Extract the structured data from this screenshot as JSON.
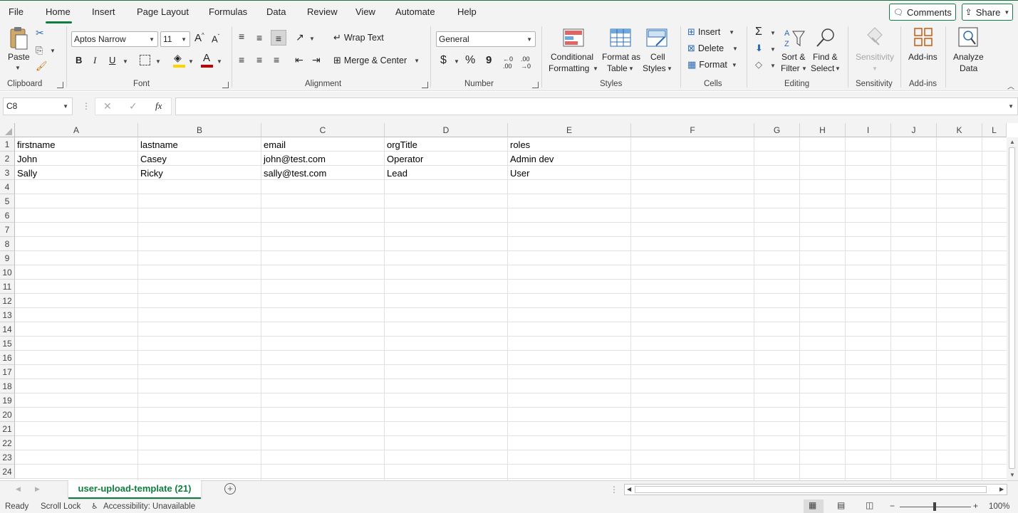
{
  "menu": {
    "items": [
      "File",
      "Home",
      "Insert",
      "Page Layout",
      "Formulas",
      "Data",
      "Review",
      "View",
      "Automate",
      "Help"
    ],
    "active": "Home",
    "comments_label": "Comments",
    "share_label": "Share"
  },
  "ribbon": {
    "clipboard": {
      "paste_label": "Paste",
      "group_label": "Clipboard"
    },
    "font": {
      "font_name": "Aptos Narrow",
      "font_size": "11",
      "bold": "B",
      "italic": "I",
      "underline": "U",
      "group_label": "Font"
    },
    "alignment": {
      "wrap_label": "Wrap Text",
      "merge_label": "Merge & Center",
      "group_label": "Alignment"
    },
    "number": {
      "format": "General",
      "currency": "$",
      "percent": "%",
      "comma": "9",
      "inc_decimal": "←0 .00",
      "dec_decimal": ".00 →0",
      "group_label": "Number"
    },
    "styles": {
      "conditional_l1": "Conditional",
      "conditional_l2": "Formatting",
      "format_table_l1": "Format as",
      "format_table_l2": "Table",
      "cell_styles_l1": "Cell",
      "cell_styles_l2": "Styles",
      "group_label": "Styles"
    },
    "cells": {
      "insert_label": "Insert",
      "delete_label": "Delete",
      "format_label": "Format",
      "group_label": "Cells"
    },
    "editing": {
      "sort_l1": "Sort &",
      "sort_l2": "Filter",
      "find_l1": "Find &",
      "find_l2": "Select",
      "group_label": "Editing"
    },
    "sensitivity": {
      "label": "Sensitivity",
      "group_label": "Sensitivity"
    },
    "addins": {
      "label": "Add-ins",
      "group_label": "Add-ins"
    },
    "analyze": {
      "label_l1": "Analyze",
      "label_l2": "Data"
    }
  },
  "formula_bar": {
    "name_box": "C8",
    "fx": "fx",
    "value": ""
  },
  "grid": {
    "columns": [
      "A",
      "B",
      "C",
      "D",
      "E",
      "F",
      "G",
      "H",
      "I",
      "J",
      "K",
      "L"
    ],
    "rows": [
      "1",
      "2",
      "3",
      "4",
      "5",
      "6",
      "7",
      "8",
      "9",
      "10",
      "11",
      "12",
      "13",
      "14",
      "15",
      "16",
      "17",
      "18",
      "19",
      "20",
      "21",
      "22",
      "23",
      "24"
    ],
    "cells": [
      [
        "firstname",
        "lastname",
        "email",
        "orgTitle",
        "roles"
      ],
      [
        "John",
        "Casey",
        "john@test.com",
        "Operator",
        "Admin dev"
      ],
      [
        "Sally",
        "Ricky",
        "sally@test.com",
        "Lead",
        "User"
      ]
    ]
  },
  "sheet_tab": {
    "name": "user-upload-template (21)"
  },
  "status": {
    "ready": "Ready",
    "scroll_lock": "Scroll Lock",
    "accessibility": "Accessibility: Unavailable",
    "zoom": "100%"
  },
  "colors": {
    "accent": "#107c41",
    "ribbon_bg": "#f3f3f3"
  }
}
